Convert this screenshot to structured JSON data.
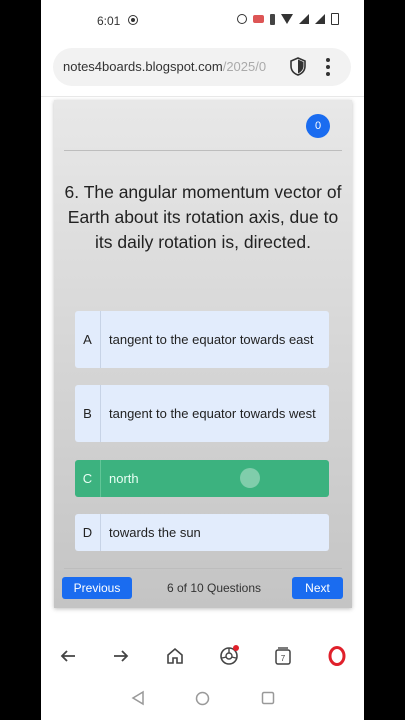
{
  "status_bar": {
    "time": "6:01"
  },
  "browser": {
    "url_main": "notes4boards.blogspot.com",
    "url_path": "/2025/0",
    "tab_count": "7"
  },
  "quiz": {
    "score": "0",
    "question": "6. The angular momentum vector of Earth about its rotation axis, due to its daily rotation is, directed.",
    "options": [
      {
        "letter": "A",
        "text": "tangent to the equator towards east"
      },
      {
        "letter": "B",
        "text": "tangent to the equator towards west"
      },
      {
        "letter": "C",
        "text": "north"
      },
      {
        "letter": "D",
        "text": "towards the sun"
      }
    ],
    "selected": "C",
    "prev_label": "Previous",
    "next_label": "Next",
    "progress": "6 of 10 Questions"
  },
  "colors": {
    "accent": "#1a6cf0",
    "selected": "#3cb27f",
    "option_bg": "#e2ecfc",
    "opera_red": "#e0202b"
  }
}
